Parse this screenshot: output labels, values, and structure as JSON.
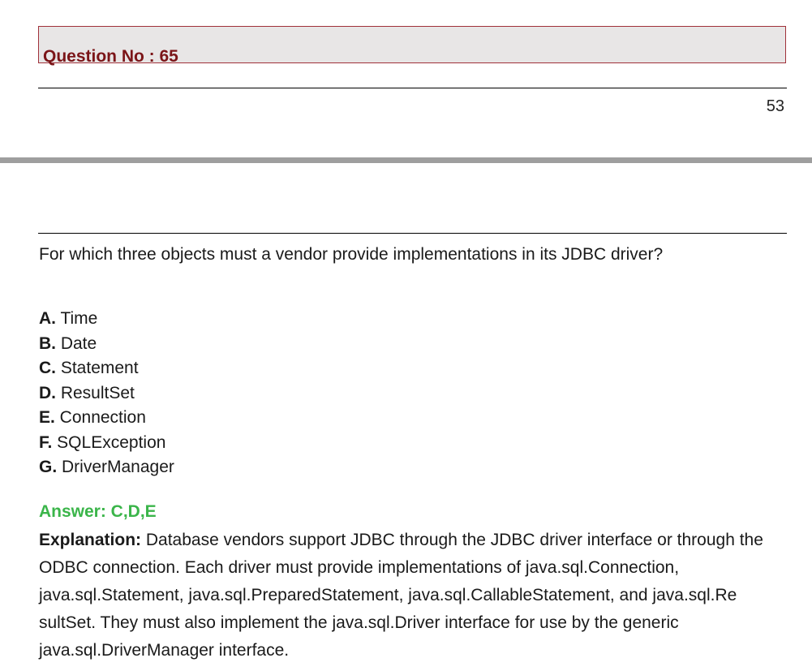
{
  "header": {
    "question_label": "Question No : 65",
    "page_number": "53"
  },
  "question": {
    "text": "For which three objects must a vendor provide implementations in its JDBC driver?"
  },
  "options": [
    {
      "letter": "A.",
      "text": " Time"
    },
    {
      "letter": "B.",
      "text": " Date"
    },
    {
      "letter": "C.",
      "text": " Statement"
    },
    {
      "letter": "D.",
      "text": " ResultSet"
    },
    {
      "letter": "E.",
      "text": " Connection"
    },
    {
      "letter": "F.",
      "text": " SQLException"
    },
    {
      "letter": "G.",
      "text": " DriverManager"
    }
  ],
  "answer": {
    "text": "Answer: C,D,E"
  },
  "explanation": {
    "label": "Explanation:",
    "text": " Database vendors support JDBC through the JDBC driver interface or through the ODBC connection. Each driver must provide implementations of java.sql.Connection, java.sql.Statement, java.sql.PreparedStatement, java.sql.CallableStatement, and java.sql.Re sultSet. They must also implement the java.sql.Driver interface for use by the generic java.sql.DriverManager interface."
  },
  "colors": {
    "question_title": "#7b1518",
    "question_box_bg": "#e8e6e6",
    "question_box_border": "#a0313a",
    "answer": "#3bb54a",
    "page_break": "#9e9e9e"
  }
}
